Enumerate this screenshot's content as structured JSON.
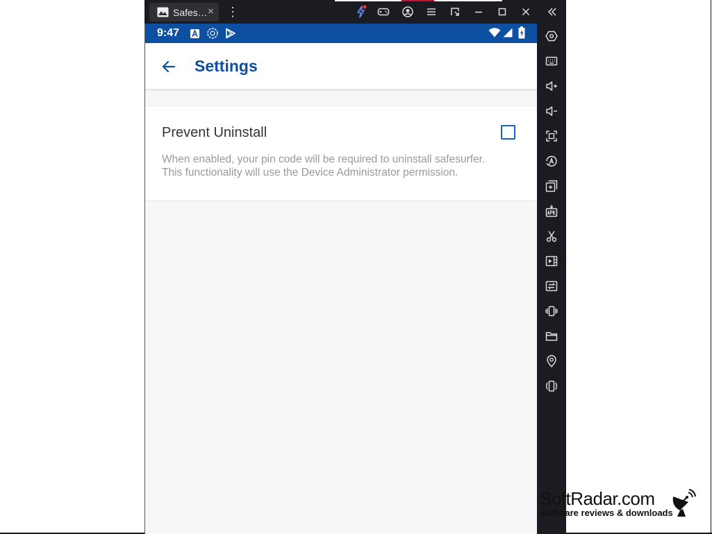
{
  "window": {
    "tab_title": "Safes…",
    "tab_close": "×",
    "menu_glyph": "⋮"
  },
  "titlebar_buttons": [
    "bolt-icon",
    "gamepad-icon",
    "account-icon",
    "menu-icon",
    "restore-window-icon",
    "minimize-icon",
    "maximize-icon",
    "close-icon",
    "collapse-sidebar-icon"
  ],
  "status_bar": {
    "time": "9:47"
  },
  "app_bar": {
    "title": "Settings"
  },
  "preference": {
    "title": "Prevent Uninstall",
    "description": "When enabled, your pin code will be required to uninstall safesurfer. This functionality will use the Device Administrator permission.",
    "checked": false
  },
  "sidebar_tools": [
    "settings-hex-icon",
    "keyboard-icon",
    "volume-up-icon",
    "volume-down-icon",
    "screenshot-icon",
    "auto-rotate-icon",
    "multi-instance-icon",
    "apk-install-icon",
    "scissors-icon",
    "screen-record-icon",
    "sync-icon",
    "shake-icon",
    "folder-icon",
    "location-icon",
    "rotate-icon"
  ],
  "watermark": {
    "brand": "SoftRadar.com",
    "tagline": "Software reviews & downloads"
  },
  "colors": {
    "accent": "#0d4fa0",
    "emulator_chrome": "#1b1c21",
    "screen_bg": "#f7f7f7"
  }
}
